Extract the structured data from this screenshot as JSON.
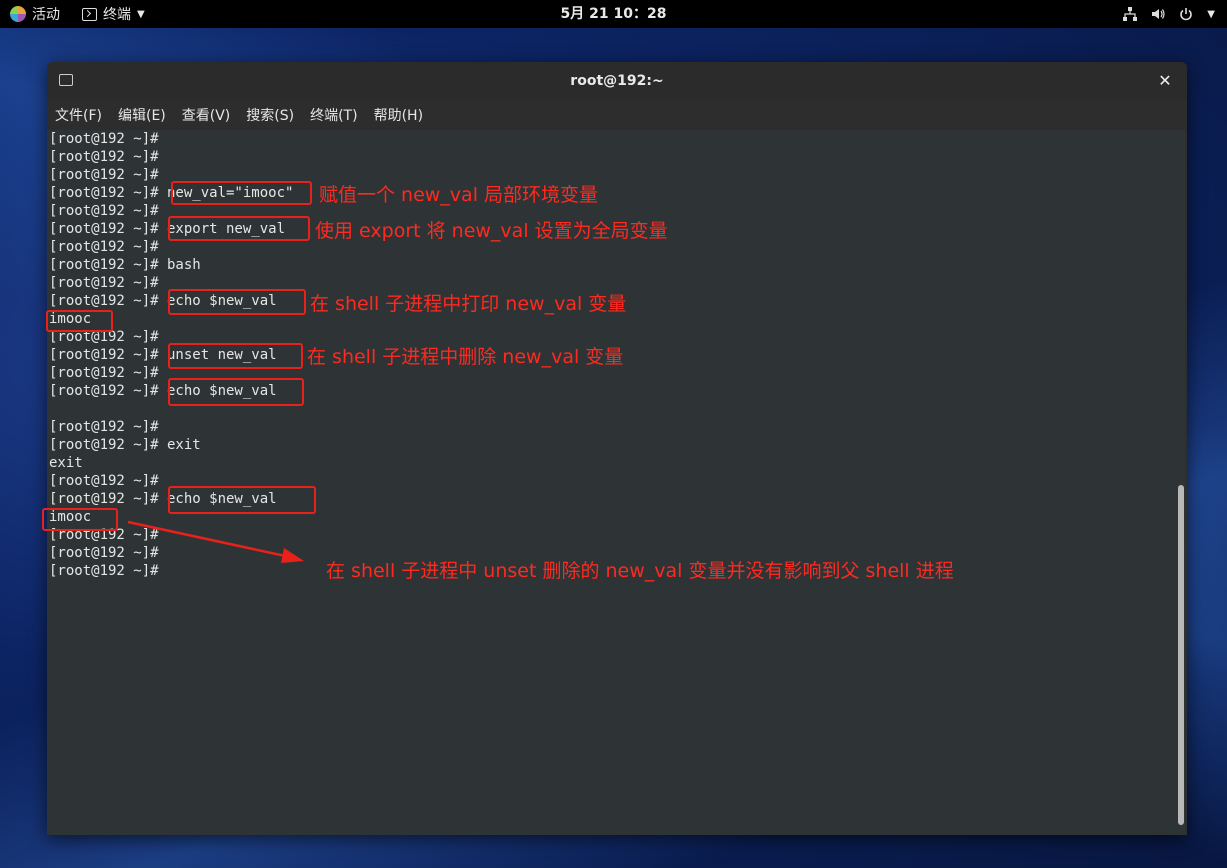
{
  "topbar": {
    "activities": "活动",
    "app_menu": "终端",
    "clock": "5月 21  10：28"
  },
  "window": {
    "title": "root@192:~",
    "close_glyph": "✕"
  },
  "menubar": {
    "items": [
      "文件(F)",
      "编辑(E)",
      "查看(V)",
      "搜索(S)",
      "终端(T)",
      "帮助(H)"
    ]
  },
  "terminal": {
    "lines": [
      "[root@192 ~]#",
      "[root@192 ~]#",
      "[root@192 ~]#",
      "[root@192 ~]# new_val=\"imooc\"",
      "[root@192 ~]#",
      "[root@192 ~]# export new_val",
      "[root@192 ~]#",
      "[root@192 ~]# bash",
      "[root@192 ~]#",
      "[root@192 ~]# echo $new_val",
      "imooc",
      "[root@192 ~]#",
      "[root@192 ~]# unset new_val",
      "[root@192 ~]#",
      "[root@192 ~]# echo $new_val",
      "",
      "[root@192 ~]#",
      "[root@192 ~]# exit",
      "exit",
      "[root@192 ~]#",
      "[root@192 ~]# echo $new_val",
      "imooc",
      "[root@192 ~]#",
      "[root@192 ~]#",
      "[root@192 ~]#"
    ]
  },
  "annotations": {
    "note1": "赋值一个 new_val 局部环境变量",
    "note2": "使用 export 将 new_val 设置为全局变量",
    "note3": "在 shell 子进程中打印 new_val 变量",
    "note4": "在 shell 子进程中删除 new_val 变量",
    "note5": "在 shell 子进程中 unset 删除的 new_val 变量并没有影响到父 shell 进程",
    "color": "#e8211b"
  },
  "colors": {
    "terminal_bg": "#2e3436",
    "terminal_fg": "#e6e6e6",
    "topbar_bg": "#000000"
  }
}
